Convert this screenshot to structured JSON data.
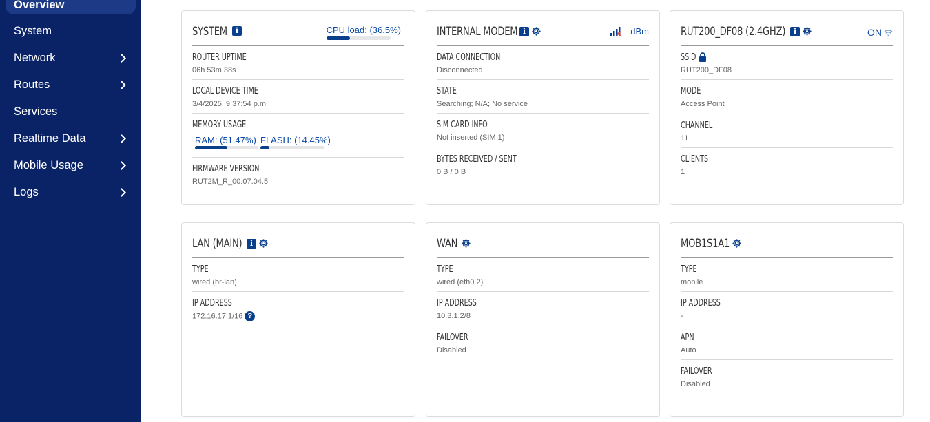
{
  "sidebar": {
    "items": [
      {
        "label": "Overview",
        "active": true,
        "submenu": false
      },
      {
        "label": "System",
        "submenu": false
      },
      {
        "label": "Network",
        "submenu": true
      },
      {
        "label": "Routes",
        "submenu": true
      },
      {
        "label": "Services",
        "submenu": false
      },
      {
        "label": "Realtime Data",
        "submenu": true
      },
      {
        "label": "Mobile Usage",
        "submenu": true
      },
      {
        "label": "Logs",
        "submenu": true
      }
    ]
  },
  "system": {
    "title": "SYSTEM",
    "cpu_label": "CPU load: (36.5%)",
    "cpu_fraction": 0.365,
    "uptime_label": "ROUTER UPTIME",
    "uptime_value": "06h 53m 38s",
    "time_label": "LOCAL DEVICE TIME",
    "time_value": "3/4/2025, 9:37:54 p.m.",
    "memory_label": "MEMORY USAGE",
    "ram_label": "RAM: (51.47%)",
    "ram_fraction": 0.5147,
    "flash_label": "FLASH: (14.45%)",
    "flash_fraction": 0.1445,
    "firmware_label": "FIRMWARE VERSION",
    "firmware_value": "RUT2M_R_00.07.04.5"
  },
  "modem": {
    "title": "INTERNAL MODEM",
    "signal_text": "- dBm",
    "data_label": "DATA CONNECTION",
    "data_value": "Disconnected",
    "state_label": "STATE",
    "state_value": "Searching; N/A; No service",
    "sim_label": "SIM CARD INFO",
    "sim_value": "Not inserted (SIM 1)",
    "bytes_label": "BYTES RECEIVED / SENT",
    "bytes_value": "0 B / 0 B"
  },
  "wifi": {
    "title": "RUT200_DF08 (2.4GHZ)",
    "status": "ON",
    "ssid_label": "SSID",
    "ssid_value": "RUT200_DF08",
    "mode_label": "MODE",
    "mode_value": "Access Point",
    "channel_label": "CHANNEL",
    "channel_value": "11",
    "clients_label": "CLIENTS",
    "clients_value": "1"
  },
  "lan": {
    "title": "LAN (MAIN)",
    "type_label": "TYPE",
    "type_value": "wired (br-lan)",
    "ip_label": "IP ADDRESS",
    "ip_value": "172.16.17.1/16",
    "help": "?"
  },
  "wan": {
    "title": "WAN",
    "type_label": "TYPE",
    "type_value": "wired (eth0.2)",
    "ip_label": "IP ADDRESS",
    "ip_value": "10.3.1.2/8",
    "failover_label": "FAILOVER",
    "failover_value": "Disabled"
  },
  "mobile": {
    "title": "MOB1S1A1",
    "type_label": "TYPE",
    "type_value": "mobile",
    "ip_label": "IP ADDRESS",
    "ip_value": "-",
    "apn_label": "APN",
    "apn_value": "Auto",
    "failover_label": "FAILOVER",
    "failover_value": "Disabled"
  },
  "colors": {
    "sidebar_bg": "#0a2366",
    "accent": "#0a3f8c",
    "link": "#0a4aa6"
  }
}
